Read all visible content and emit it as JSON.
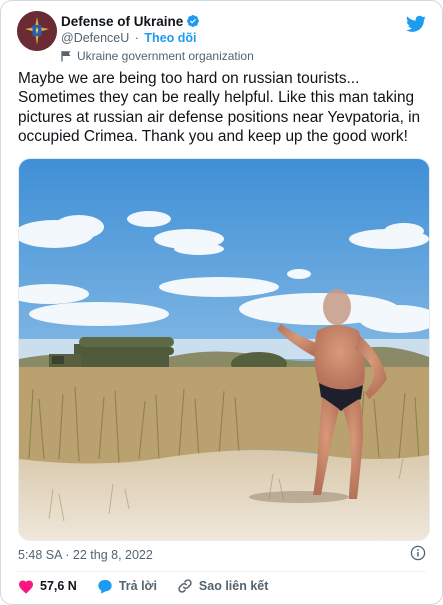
{
  "author": {
    "display_name": "Defense of Ukraine",
    "handle": "@DefenceU",
    "separator": "·",
    "follow_label": "Theo dõi",
    "gov_label": "Ukraine government organization"
  },
  "tweet": {
    "text": "Maybe we are being too hard on russian tourists...\nSometimes they can be really helpful. Like this man taking\npictures at russian air defense positions near Yevpatoria, in\noccupied Crimea. Thank you and keep up the good work!",
    "timestamp": "5:48 SA · 22 thg 8, 2022"
  },
  "actions": {
    "like_count": "57,6 N",
    "reply_label": "Trả lời",
    "copy_link_label": "Sao liên kết"
  },
  "icons": {
    "verified": "verified-badge-icon",
    "twitter": "twitter-bird-icon",
    "gov_flag": "flag-icon",
    "info": "info-icon",
    "like": "heart-icon",
    "reply": "reply-bubble-icon",
    "link": "link-icon"
  },
  "colors": {
    "accent": "#1d9bf0",
    "like": "#f91880",
    "muted": "#536471",
    "text": "#0f1419"
  }
}
